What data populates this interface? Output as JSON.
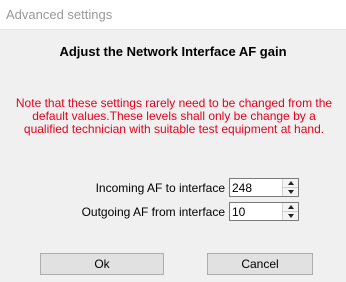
{
  "window": {
    "title": "Advanced settings"
  },
  "dialog": {
    "heading": "Adjust the Network Interface AF gain",
    "warning_lines": [
      "Note that these settings rarely need to be changed from the",
      "default values.These levels shall only be change by a",
      "qualified technician with suitable test equipment at hand."
    ],
    "fields": [
      {
        "label": "Incoming AF to interface",
        "value": "248"
      },
      {
        "label": "Outgoing AF from interface",
        "value": "10"
      }
    ],
    "buttons": {
      "ok_label": "Ok",
      "cancel_label": "Cancel"
    }
  },
  "colors": {
    "warning_text": "#e8001c",
    "dialog_background": "#f0f0f0",
    "title_text": "#9a9a9a"
  }
}
